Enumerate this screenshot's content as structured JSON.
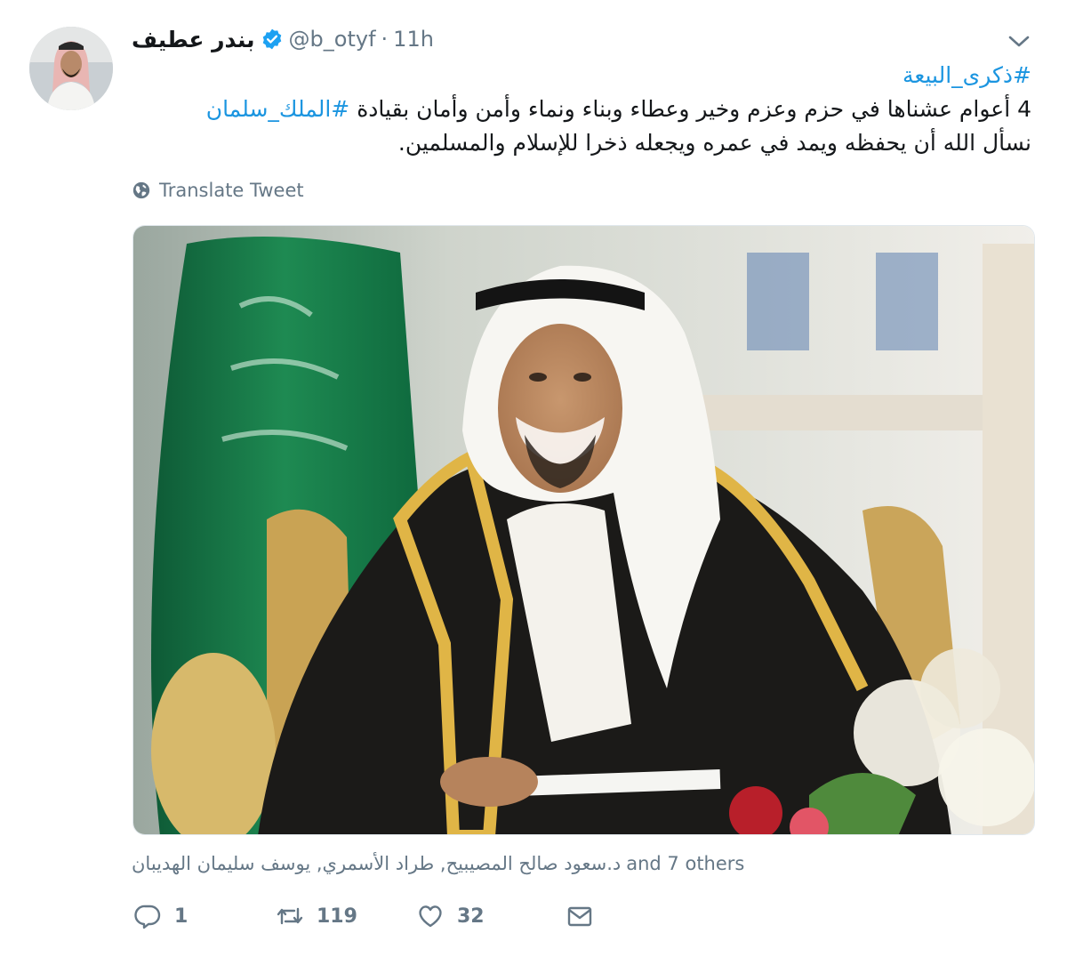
{
  "author": {
    "name": "بندر عطيف",
    "handle": "@b_otyf",
    "separator": "·",
    "time": "11h",
    "verified": true
  },
  "tweet": {
    "line1_hashtag": "#ذكرى_البيعة",
    "line2_text": "4 أعوام عشناها في حزم وعزم وخير وعطاء وبناء ونماء وأمن وأمان بقيادة ",
    "line2_hashtag": "#الملك_سلمان",
    "line3_text": "نسأل الله أن يحفظه ويمد في عمره ويجعله ذخرا للإسلام والمسلمين."
  },
  "translate_label": "Translate Tweet",
  "liked_by": {
    "names": "د.سعود صالح المصيبيح, طراد الأسمري, يوسف سليمان الهديبان",
    "others": "and 7 others"
  },
  "actions": {
    "replies": "1",
    "retweets": "119",
    "likes": "32"
  },
  "icons": {
    "verified": "verified-badge-icon",
    "caret": "chevron-down-icon",
    "translate": "globe-icon",
    "reply": "reply-icon",
    "retweet": "retweet-icon",
    "like": "heart-icon",
    "message": "direct-message-icon"
  },
  "colors": {
    "link": "#1b95e0",
    "secondary": "#657786",
    "text": "#14171a",
    "verified": "#1da1f2"
  }
}
